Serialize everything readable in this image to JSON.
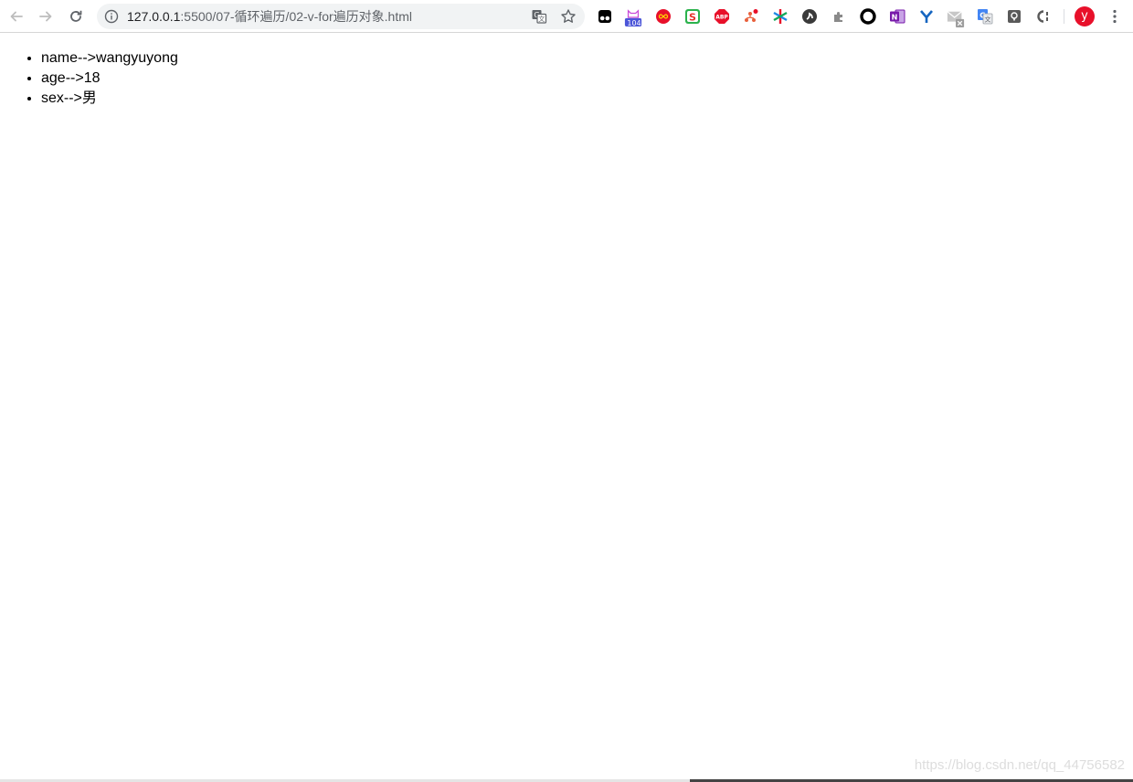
{
  "browser": {
    "url_host": "127.0.0.1",
    "url_path": ":5500/07-循环遍历/02-v-for遍历对象.html",
    "extension_badge": "104",
    "profile_initial": "y",
    "extensions": [
      "tampermonkey-icon",
      "badge-104-icon",
      "infinity-icon",
      "s-extension-icon",
      "adblock-plus-icon",
      "tree-extension-icon",
      "color-star-icon",
      "circle-dark-icon",
      "puzzle-gray-icon",
      "ring-icon",
      "onenote-icon",
      "y-extension-icon",
      "mail-disabled-icon",
      "google-translate-icon",
      "lock-box-icon",
      "c-bracket-icon"
    ]
  },
  "page": {
    "items": [
      {
        "text": "name-->wangyuyong"
      },
      {
        "text": "age-->18"
      },
      {
        "text": "sex-->男"
      }
    ]
  },
  "watermark": "https://blog.csdn.net/qq_44756582",
  "colors": {
    "avatar_bg": "#e8102a",
    "omnibox_bg": "#f1f3f4"
  }
}
